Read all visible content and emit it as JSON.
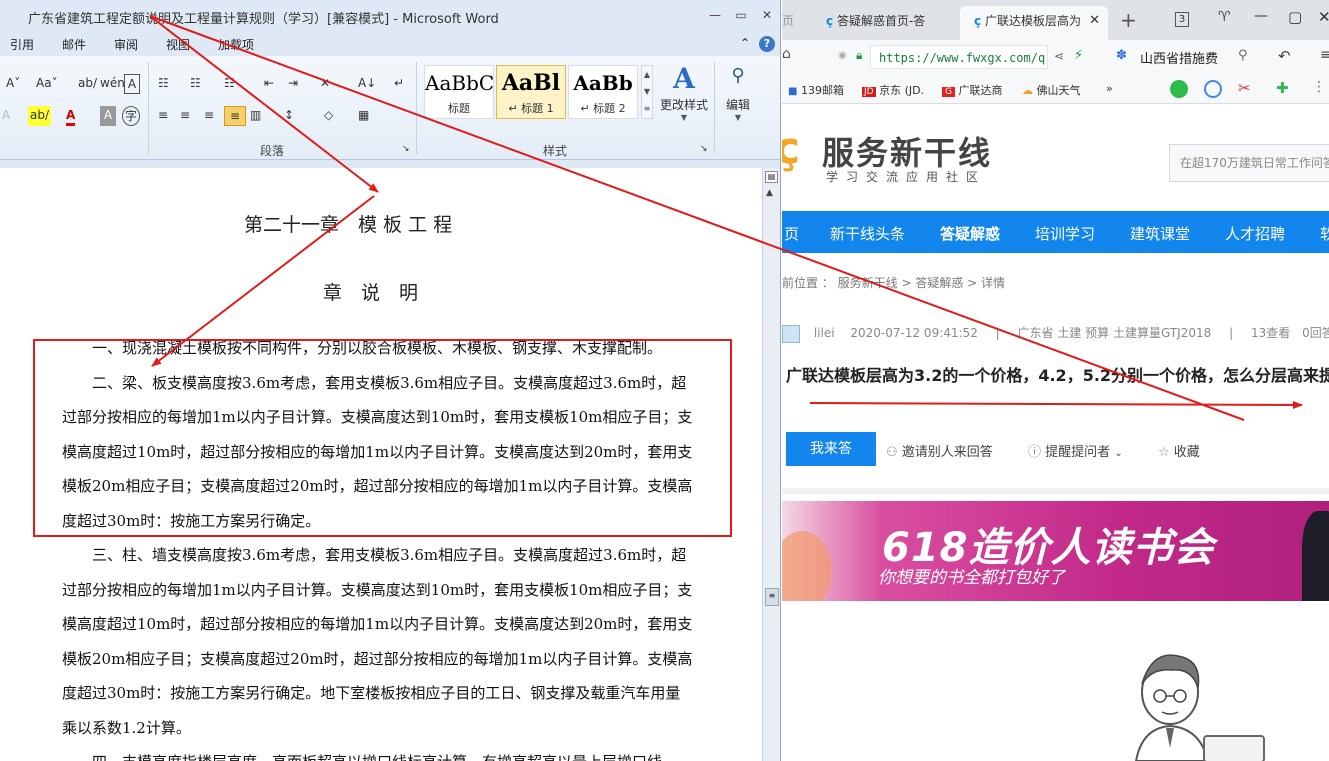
{
  "word": {
    "title": "广东省建筑工程定额说明及工程量计算规则（学习）[兼容模式] - Microsoft Word",
    "window_controls": [
      "—",
      "▭",
      "✕"
    ],
    "menu_tabs": [
      "引用",
      "邮件",
      "审阅",
      "视图",
      "加载项"
    ],
    "ribbon": {
      "font_row1": [
        "A˅",
        "Aa˅",
        "ab/",
        "wén",
        "A"
      ],
      "font_row2": [
        "A",
        "ab/",
        "A",
        "A",
        "字"
      ],
      "para_row1": [
        "☷",
        "☷",
        "☷",
        "⇤",
        "⇥",
        "✕",
        "A↓",
        "↵"
      ],
      "para_row2": [
        "≡",
        "≡",
        "≡",
        "≡",
        "▥",
        "↕",
        "◇",
        "▦"
      ],
      "styles": [
        {
          "sample": "AaBbC",
          "name": "标题"
        },
        {
          "sample": "AaBl",
          "name": "↵ 标题 1"
        },
        {
          "sample": "AaBb",
          "name": "↵ 标题 2"
        }
      ],
      "change_styles_label": "更改样式",
      "edit_label": "编辑",
      "group_paragraph": "段落",
      "group_styles": "样式"
    },
    "document": {
      "chapter_title": "第二十一章　模 板 工 程",
      "section_title": "章　说　明",
      "lines": [
        "　　一、现浇混凝土模板按不同构件，分别以胶合板模板、木模板、钢支撑、木支撑配制。",
        "　　二、梁、板支模高度按3.6m考虑，套用支模板3.6m相应子目。支模高度超过3.6m时，超",
        "过部分按相应的每增加1m以内子目计算。支模高度达到10m时，套用支模板10m相应子目；支",
        "模高度超过10m时，超过部分按相应的每增加1m以内子目计算。支模高度达到20m时，套用支",
        "模板20m相应子目；支模高度超过20m时，超过部分按相应的每增加1m以内子目计算。支模高",
        "度超过30m时：按施工方案另行确定。",
        "　　三、柱、墙支模高度按3.6m考虑，套用支模板3.6m相应子目。支模高度超过3.6m时，超",
        "过部分按相应的每增加1m以内子目计算。支模高度达到10m时，套用支模板10m相应子目；支",
        "模高度超过10m时，超过部分按相应的每增加1m以内子目计算。支模高度达到20m时，套用支",
        "模板20m相应子目；支模高度超过20m时，超过部分按相应的每增加1m以内子目计算。支模高",
        "度超过30m时：按施工方案另行确定。地下室楼板按相应子目的工日、钢支撑及载重汽车用量",
        "乘以系数1.2计算。",
        "　　四、支模高度指楼层高度，高而板超高以增口线标高计算，有增高超高以最上层增口线"
      ]
    }
  },
  "browser": {
    "tabs": [
      {
        "label": "答疑解惑首页-答"
      },
      {
        "label": "广联达模板层高为"
      }
    ],
    "tab_count": "3",
    "new_tab": "+",
    "url": "https://www.fwxgx.com/q",
    "search_hint": "山西省措施费",
    "bookmarks": [
      "139邮箱",
      "京东 (JD.",
      "广联达商",
      "佛山天气",
      "»"
    ],
    "site": {
      "logo_text": "服务新干线",
      "tagline": "学习交流应用社区",
      "search_placeholder": "在超170万建筑日常工作问答",
      "nav": [
        "页",
        "新干线头条",
        "答疑解惑",
        "培训学习",
        "建筑课堂",
        "人才招聘",
        "软"
      ],
      "breadcrumb": "前位置 ： 服务新干线 > 答疑解惑 > 详情",
      "meta": {
        "user": "lilei",
        "date": "2020-07-12 09:41:52",
        "tags": "广东省  土建  预算  土建算量GTJ2018",
        "views": "13查看",
        "answers": "0回答"
      },
      "question_title": "广联达模板层高为3.2的一个价格，4.2，5.2分别一个价格，怎么分层高来提",
      "answer_button": "我来答",
      "invite_label": "邀请别人来回答",
      "remind_label": "提醒提问者",
      "favorite_label": "收藏",
      "banner_title": "618造价人读书会",
      "banner_sub": "你想要的书全都打包好了"
    }
  },
  "colors": {
    "annotation_red": "#e01b1b",
    "site_blue": "#1286ec",
    "word_chrome": "#dfe9f5",
    "banner_magenta": "#c32a8a"
  }
}
